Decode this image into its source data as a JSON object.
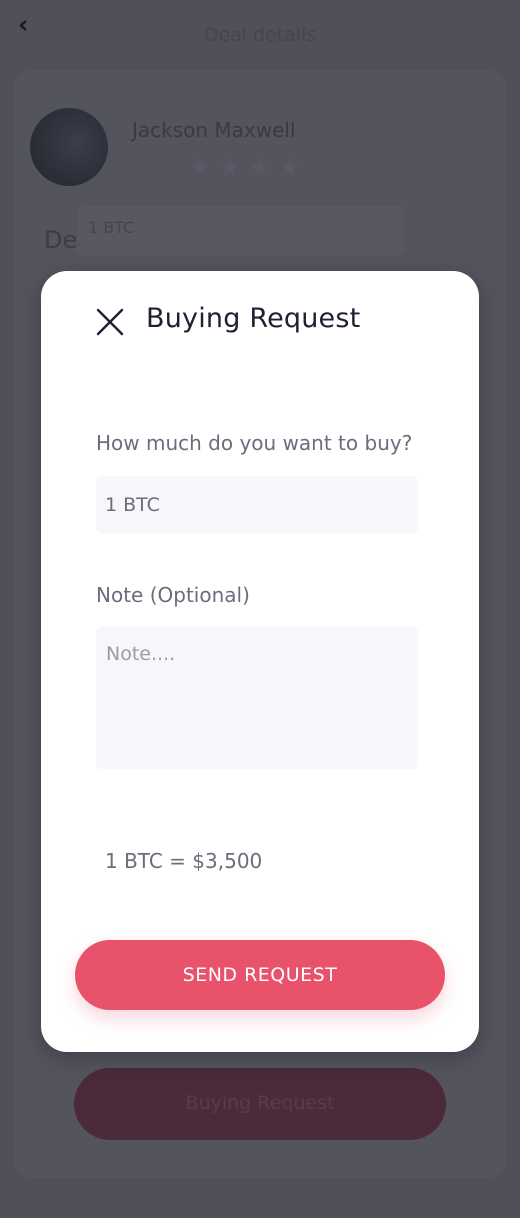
{
  "background": {
    "header_title": "Deal details",
    "user_name": "Jackson Maxwell",
    "rating_stars": 4,
    "section_label": "De",
    "field_value": "1 BTC",
    "primary_button_label": "Buying Request"
  },
  "modal": {
    "title": "Buying Request",
    "amount_label": "How much do you want to buy?",
    "amount_value": "1 BTC",
    "note_label": "Note (Optional)",
    "note_placeholder": "Note....",
    "rate_text": "1 BTC = $3,500",
    "send_button_label": "SEND REQUEST"
  },
  "colors": {
    "accent": "#e8526b",
    "overlay": "#4d4d58",
    "input_bg": "#f6f6fb",
    "text_muted": "#6b6d7c",
    "text_dark": "#1f2030"
  },
  "icons": {
    "back": "chevron-left-icon",
    "close": "close-icon",
    "star": "star-icon"
  }
}
